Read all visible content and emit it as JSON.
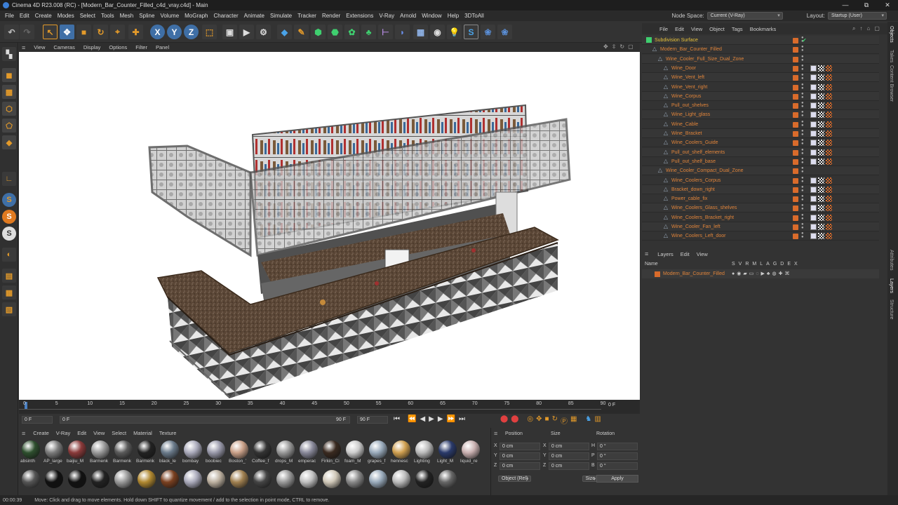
{
  "titlebar": {
    "title": "Cinema 4D R23.008 (RC) - [Modern_Bar_Counter_Filled_c4d_vray.c4d] - Main",
    "minimize": "—",
    "restore": "⧉",
    "close": "✕"
  },
  "menubar": {
    "items": [
      "File",
      "Edit",
      "Create",
      "Modes",
      "Select",
      "Tools",
      "Mesh",
      "Spline",
      "Volume",
      "MoGraph",
      "Character",
      "Animate",
      "Simulate",
      "Tracker",
      "Render",
      "Extensions",
      "V-Ray",
      "Arnold",
      "Window",
      "Help",
      "3DToAll"
    ]
  },
  "nodespace": {
    "label": "Node Space:",
    "value": "Current (V-Ray)",
    "layout_label": "Layout:",
    "layout_value": "Startup (User)"
  },
  "toolbar": {
    "axis_x": "X",
    "axis_y": "Y",
    "axis_z": "Z"
  },
  "viewport": {
    "menu": [
      "View",
      "Cameras",
      "Display",
      "Options",
      "Filter",
      "Panel"
    ]
  },
  "timeline": {
    "ticks": [
      "0",
      "5",
      "10",
      "15",
      "20",
      "25",
      "30",
      "35",
      "40",
      "45",
      "50",
      "55",
      "60",
      "65",
      "70",
      "75",
      "80",
      "85",
      "90"
    ],
    "current_frame": "0 F"
  },
  "playbar": {
    "start": "0 F",
    "range_start": "0 F",
    "range_end": "90 F",
    "end": "90 F"
  },
  "materials": {
    "menu": [
      "Create",
      "V-Ray",
      "Edit",
      "View",
      "Select",
      "Material",
      "Texture"
    ],
    "row1": [
      "absinth",
      "AP_large",
      "baijiu_M",
      "Barmenk",
      "Barmenk",
      "Barmenk",
      "black_le",
      "bombay",
      "boobiec",
      "Boston_’",
      "Coffee_f",
      "drops_M",
      "emperac",
      "Firkin_Ci",
      "foam_M",
      "grapes_f",
      "hennesc",
      "Lighting",
      "Light_M",
      "liquid_re"
    ],
    "row2": [
      "",
      "",
      "",
      "",
      "",
      "",
      "",
      "",
      "",
      "",
      "",
      "",
      "",
      "",
      "",
      "",
      "",
      "",
      ""
    ]
  },
  "coords": {
    "headers": [
      "Position",
      "Size",
      "Rotation"
    ],
    "rows": [
      {
        "axis": "X",
        "pos": "0 cm",
        "sizeaxis": "X",
        "size": "0 cm",
        "rotaxis": "H",
        "rot": "0 °"
      },
      {
        "axis": "Y",
        "pos": "0 cm",
        "sizeaxis": "Y",
        "size": "0 cm",
        "rotaxis": "P",
        "rot": "0 °"
      },
      {
        "axis": "Z",
        "pos": "0 cm",
        "sizeaxis": "Z",
        "size": "0 cm",
        "rotaxis": "B",
        "rot": "0 °"
      }
    ],
    "mode": "Object (Rel)",
    "size_mode": "Size",
    "apply": "Apply"
  },
  "objects": {
    "menu": [
      "File",
      "Edit",
      "View",
      "Object",
      "Tags",
      "Bookmarks"
    ],
    "items": [
      {
        "name": "Subdivision Surface",
        "level": 0,
        "color": "#e8c23a",
        "tags": false
      },
      {
        "name": "Modern_Bar_Counter_Filled",
        "level": 1,
        "color": "#e0843a",
        "tags": false
      },
      {
        "name": "Wine_Cooler_Full_Size_Dual_Zone",
        "level": 2,
        "color": "#e0843a",
        "tags": false
      },
      {
        "name": "Wine_Door",
        "level": 3,
        "color": "#e0843a",
        "tags": true
      },
      {
        "name": "Wine_Vent_left",
        "level": 3,
        "color": "#e0843a",
        "tags": true
      },
      {
        "name": "Wine_Vent_right",
        "level": 3,
        "color": "#e0843a",
        "tags": true
      },
      {
        "name": "Wine_Corpus",
        "level": 3,
        "color": "#e0843a",
        "tags": true
      },
      {
        "name": "Pull_out_shelves",
        "level": 3,
        "color": "#e0843a",
        "tags": true
      },
      {
        "name": "Wine_Light_glass",
        "level": 3,
        "color": "#e0843a",
        "tags": true
      },
      {
        "name": "Wine_Cable",
        "level": 3,
        "color": "#e0843a",
        "tags": true
      },
      {
        "name": "Wine_Bracket",
        "level": 3,
        "color": "#e0843a",
        "tags": true
      },
      {
        "name": "Wine_Coolers_Guide",
        "level": 3,
        "color": "#e0843a",
        "tags": true
      },
      {
        "name": "Pull_out_shelf_elements",
        "level": 3,
        "color": "#e0843a",
        "tags": true
      },
      {
        "name": "Pull_out_shelf_base",
        "level": 3,
        "color": "#e0843a",
        "tags": true
      },
      {
        "name": "Wine_Cooler_Compact_Dual_Zone",
        "level": 2,
        "color": "#e0843a",
        "tags": false
      },
      {
        "name": "Wine_Coolers_Corpus",
        "level": 3,
        "color": "#e0843a",
        "tags": true
      },
      {
        "name": "Bracket_down_right",
        "level": 3,
        "color": "#e0843a",
        "tags": true
      },
      {
        "name": "Power_cable_fix",
        "level": 3,
        "color": "#e0843a",
        "tags": true
      },
      {
        "name": "Wine_Coolers_Glass_shelves",
        "level": 3,
        "color": "#e0843a",
        "tags": true
      },
      {
        "name": "Wine_Coolers_Bracket_right",
        "level": 3,
        "color": "#e0843a",
        "tags": true
      },
      {
        "name": "Wine_Cooler_Fan_left",
        "level": 3,
        "color": "#e0843a",
        "tags": true
      },
      {
        "name": "Wine_Coolers_Left_door",
        "level": 3,
        "color": "#e0843a",
        "tags": true
      }
    ]
  },
  "layers": {
    "menu": [
      "Layers",
      "Edit",
      "View"
    ],
    "name_header": "Name",
    "cols": [
      "S",
      "V",
      "R",
      "M",
      "L",
      "A",
      "G",
      "D",
      "E",
      "X"
    ],
    "items": [
      {
        "name": "Modern_Bar_Counter_Filled"
      }
    ]
  },
  "sidetabs": [
    "Objects",
    "Takes",
    "Content Browser",
    "Attributes",
    "Layers",
    "Structure"
  ],
  "status": {
    "time": "00:00:39",
    "message": "Move: Click and drag to move elements. Hold down SHIFT to quantize movement / add to the selection in point mode, CTRL to remove."
  }
}
